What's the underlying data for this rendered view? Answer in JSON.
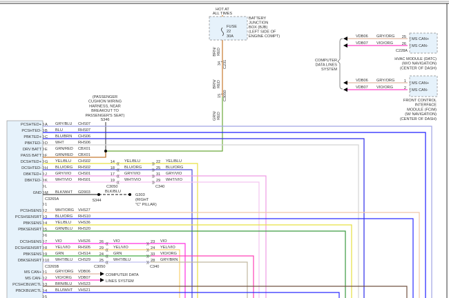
{
  "feed": {
    "hot_at": "HOT AT",
    "all_times": "ALL TIMES",
    "fuse_label": "FUSE",
    "fuse_number": "22",
    "fuse_rating": "30A",
    "bjb_lines": [
      "BATTERY",
      "JUNCTION",
      "BOX (BJB)",
      "(LEFT SIDE OF",
      "ENGINE COMPT)"
    ],
    "wire1_color": [
      "BRN/",
      "RED"
    ],
    "c231_pin": "34",
    "c231": "C231",
    "wire2_color": [
      "BRN/",
      "RED"
    ],
    "c3050_pin": "15",
    "c3050": "C3050",
    "wire3_color": [
      "GRN/",
      "RED"
    ],
    "colors": {
      "brn_red": "#c87a30",
      "grn_red": "#6aa83a"
    }
  },
  "splice_note": {
    "lines": [
      "(PASSENGER",
      "CUSHION WIRING",
      "HARNESS, NEAR",
      "BREAKOUT TO",
      "PASSENGER'S SEAT)"
    ],
    "splice": "S346"
  },
  "connector_a": {
    "name": "C3265A",
    "rows": [
      {
        "pin": "A",
        "name": "PCSHTED+",
        "color": "GRY/BLU",
        "circuit": "CHS07",
        "wire": "#a0a4e4"
      },
      {
        "pin": "B",
        "name": "PCSHTED-",
        "color": "BLU",
        "circuit": "RHS07",
        "wire": "#1e1eff"
      },
      {
        "pin": "C",
        "name": "PBKTED+",
        "color": "BLU/BRN",
        "circuit": "CHS06",
        "wire": "#2a2ae8"
      },
      {
        "pin": "D",
        "name": "PBKTED-",
        "color": "WHT",
        "circuit": "RHS06",
        "wire": "#d4d4d4"
      },
      {
        "pin": "E",
        "name": "DRV BATT",
        "color": "GRN/RED",
        "circuit": "CBX01",
        "wire": "#6aa83a"
      },
      {
        "pin": "F",
        "name": "PASS BATT",
        "color": "GRN/RED",
        "circuit": "CBX01",
        "wire": "#c87a30"
      },
      {
        "pin": "G",
        "name": "DCSHTED+",
        "color": "YEL/BLU",
        "circuit": "CHS02",
        "wire": "#e8e040",
        "mid_pin": "14",
        "mid_color": "YEL/BLU",
        "far_pin": "22",
        "far_color": "YEL/BLU"
      },
      {
        "pin": "H",
        "name": "DCSHTED-",
        "color": "BLU/ORG",
        "circuit": "RHS02",
        "wire": "#4a4ad8",
        "mid_pin": "18",
        "mid_color": "BLU/ORG",
        "far_pin": "25",
        "far_color": "BLU/ORG"
      },
      {
        "pin": "J",
        "name": "DBKTED+",
        "color": "GRY/VIO",
        "circuit": "CHS01",
        "wire": "#ee9ae4",
        "mid_pin": "17",
        "mid_color": "GRY/VIO",
        "far_pin": "31",
        "far_color": "GRY/VIO"
      },
      {
        "pin": "K",
        "name": "DBKTED-",
        "color": "WHT/VIO",
        "circuit": "RHS01",
        "wire": "#f4c4f0",
        "mid_pin": "19",
        "mid_color": "WHT/VIO",
        "far_pin": "29",
        "far_color": "WHT/VIO"
      },
      {
        "pin": "L",
        "name": "",
        "color": "",
        "circuit": "",
        "wire": ""
      },
      {
        "pin": "M",
        "name": "GND",
        "color": "BLK/WHT",
        "circuit": "GD903",
        "wire": "#444444"
      }
    ],
    "mid_connector": "C3050",
    "far_connector": "C340",
    "ground": {
      "splice": "S344",
      "color": "BLK/BLU",
      "point": "G303",
      "location": [
        "(RIGHT",
        "\"C\" PILLAR)"
      ]
    }
  },
  "connector_b": {
    "name": "C3265B",
    "rows": [
      {
        "pin": "1",
        "name": "",
        "color": "",
        "circuit": "",
        "wire": ""
      },
      {
        "pin": "2",
        "name": "PCSHSENS",
        "color": "WHT/ORG",
        "circuit": "VHS27",
        "wire": "#f0c8a8"
      },
      {
        "pin": "3",
        "name": "PCSHSENSRT",
        "color": "BLU/ORG",
        "circuit": "RHS10",
        "wire": "#2a2aff"
      },
      {
        "pin": "4",
        "name": "PBKSENS",
        "color": "YEL/BLU",
        "circuit": "VHS36",
        "wire": "#e6e040"
      },
      {
        "pin": "5",
        "name": "PBKSENSRT",
        "color": "GRN/BLU",
        "circuit": "RHS20",
        "wire": "#3a9a40"
      },
      {
        "pin": "6",
        "name": "",
        "color": "",
        "circuit": "",
        "wire": ""
      },
      {
        "pin": "7",
        "name": "DCSHSENS",
        "color": "VIO",
        "circuit": "VHS26",
        "wire": "#ff30e0",
        "mid_pin": "26",
        "mid_color": "VIO",
        "far_pin": "23",
        "far_color": "VIO"
      },
      {
        "pin": "8",
        "name": "DCSHSENSRT",
        "color": "YEL/VIO",
        "circuit": "RHS05",
        "wire": "#f8d070",
        "mid_pin": "29",
        "mid_color": "YEL/VIO",
        "far_pin": "24",
        "far_color": "YEL/VIO"
      },
      {
        "pin": "9",
        "name": "PBKSENS",
        "color": "GRN",
        "circuit": "CHS14",
        "wire": "#44aa44",
        "mid_pin": "24",
        "mid_color": "GRN",
        "far_pin": "33",
        "far_color": "VIO/ORG",
        "far_wire": "#ff40b8"
      },
      {
        "pin": "10",
        "name": "DBKSENSRT",
        "color": "WHT/BLU",
        "circuit": "CHS29",
        "wire": "#c0c0f0",
        "mid_pin": "25",
        "mid_color": "WHT/BLU",
        "far_pin": "28",
        "far_color": "GRY/BRN",
        "far_wire": "#c0b8a0"
      }
    ],
    "mid_connector": "C3050",
    "far_connector": "C340"
  },
  "connector_c": {
    "rows": [
      {
        "pin": "1",
        "name": "MS CAN+",
        "color": "GRY/ORG",
        "circuit": "VDB06",
        "wire": "#e0b8a0"
      },
      {
        "pin": "2",
        "name": "MS CAN-",
        "color": "VIO/ORG",
        "circuit": "VDB07",
        "wire": "#ff40c8"
      },
      {
        "pin": "3",
        "name": "PCSHCBLWCTL",
        "color": "BRN/BLU",
        "circuit": "VHS23",
        "wire": "#705040"
      },
      {
        "pin": "4",
        "name": "PBCKBLWCTL",
        "color": "BLU/WHT",
        "circuit": "VHS21",
        "wire": "#2a2aff"
      },
      {
        "pin": "5",
        "name": "",
        "color": "",
        "circuit": "",
        "wire": ""
      }
    ],
    "data_lines_ref": [
      "COMPUTER DATA",
      "LINES SYSTEM"
    ]
  },
  "data_lines": {
    "label": [
      "COMPUTER",
      "DATA LINES",
      "SYSTEM"
    ],
    "hvac": {
      "wires": [
        {
          "circuit": "VDB06",
          "color": "GRY/ORG",
          "pin": "25",
          "signal": "MS CAN+",
          "wire": "#e0b8a0"
        },
        {
          "circuit": "VDB07",
          "color": "VIO/ORG",
          "pin": "26",
          "signal": "MS CAN-",
          "wire": "#ff40c8"
        }
      ],
      "connector": "C228A",
      "lines": [
        "HVAC MODULE (DATC)",
        "(W/O NAVIGATION)",
        "(CENTER OF DASH)"
      ]
    },
    "fcim": {
      "wires": [
        {
          "circuit": "VDB06",
          "color": "GRY/ORG",
          "pin": "1",
          "signal": "MS CAN+",
          "wire": "#e0b8a0"
        },
        {
          "circuit": "VDB07",
          "color": "VIO/ORG",
          "pin": "2",
          "signal": "MS CAN-",
          "wire": "#ff40c8"
        }
      ],
      "lines": [
        "FRONT CONTROL",
        "INTERFACE",
        "MODULE (FCIM)",
        "(W/ NAVIGATION)",
        "(CENTER OF DASH)"
      ]
    }
  }
}
